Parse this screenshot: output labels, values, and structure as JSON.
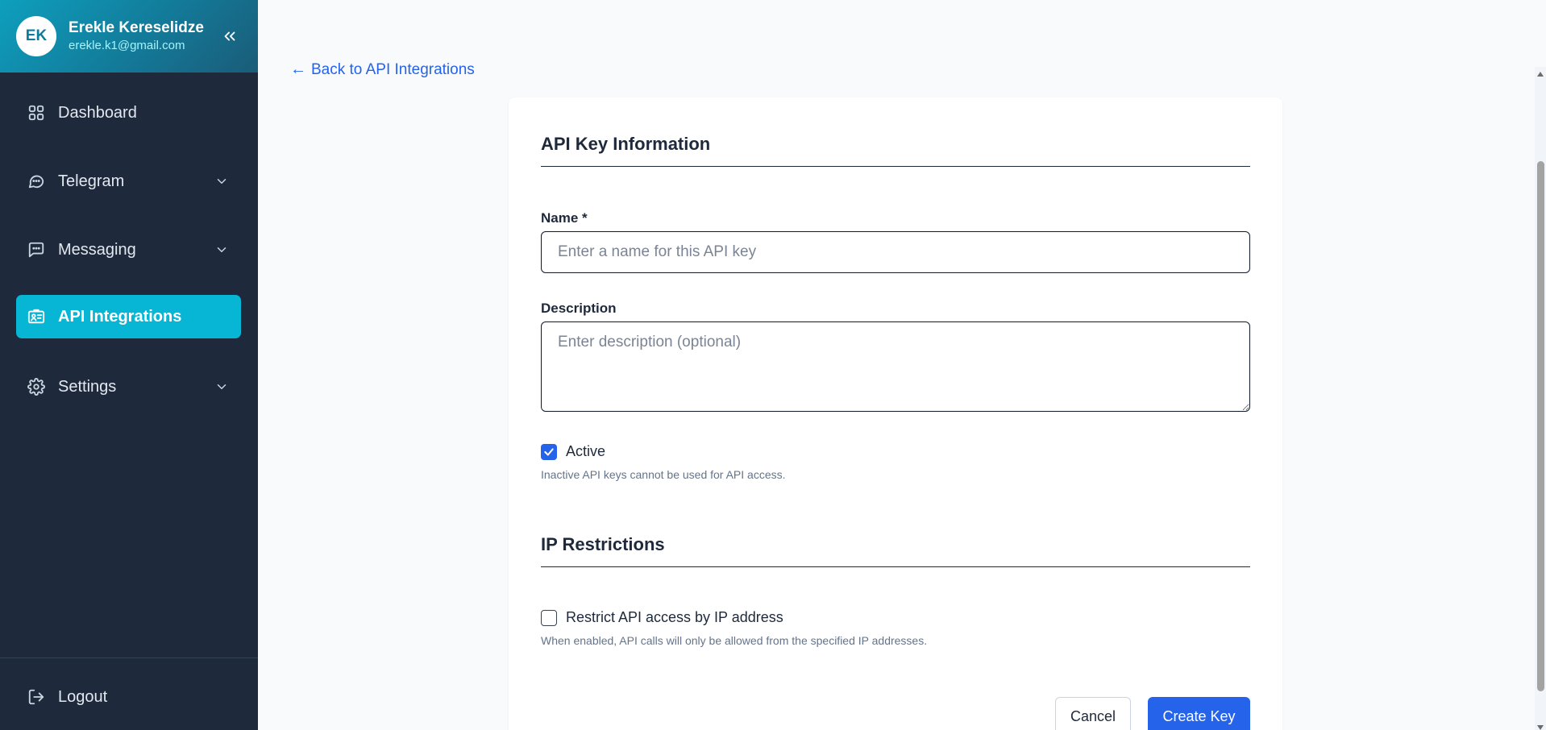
{
  "user": {
    "initials": "EK",
    "name": "Erekle Kereselidze",
    "email": "erekle.k1@gmail.com"
  },
  "sidebar": {
    "collapse_icon": "chevrons-left-icon",
    "items": [
      {
        "label": "Dashboard",
        "icon": "grid-icon",
        "expandable": false,
        "active": false
      },
      {
        "label": "Telegram",
        "icon": "chat-bubble-icon",
        "expandable": true,
        "active": false
      },
      {
        "label": "Messaging",
        "icon": "message-square-icon",
        "expandable": true,
        "active": false
      },
      {
        "label": "API Integrations",
        "icon": "id-card-icon",
        "expandable": false,
        "active": true
      },
      {
        "label": "Settings",
        "icon": "gear-icon",
        "expandable": true,
        "active": false
      }
    ],
    "logout_label": "Logout"
  },
  "main": {
    "back_link": "Back to API Integrations",
    "form": {
      "section_info_title": "API Key Information",
      "name_label": "Name *",
      "name_value": "",
      "name_placeholder": "Enter a name for this API key",
      "description_label": "Description",
      "description_value": "",
      "description_placeholder": "Enter description (optional)",
      "active_label": "Active",
      "active_checked": true,
      "active_help": "Inactive API keys cannot be used for API access.",
      "section_ip_title": "IP Restrictions",
      "restrict_label": "Restrict API access by IP address",
      "restrict_checked": false,
      "restrict_help": "When enabled, API calls will only be allowed from the specified IP addresses.",
      "cancel_label": "Cancel",
      "create_label": "Create Key"
    }
  },
  "colors": {
    "sidebar_bg": "#1e293b",
    "active_item": "#06b6d4",
    "primary": "#2563eb",
    "page_bg": "#f8fafc"
  }
}
